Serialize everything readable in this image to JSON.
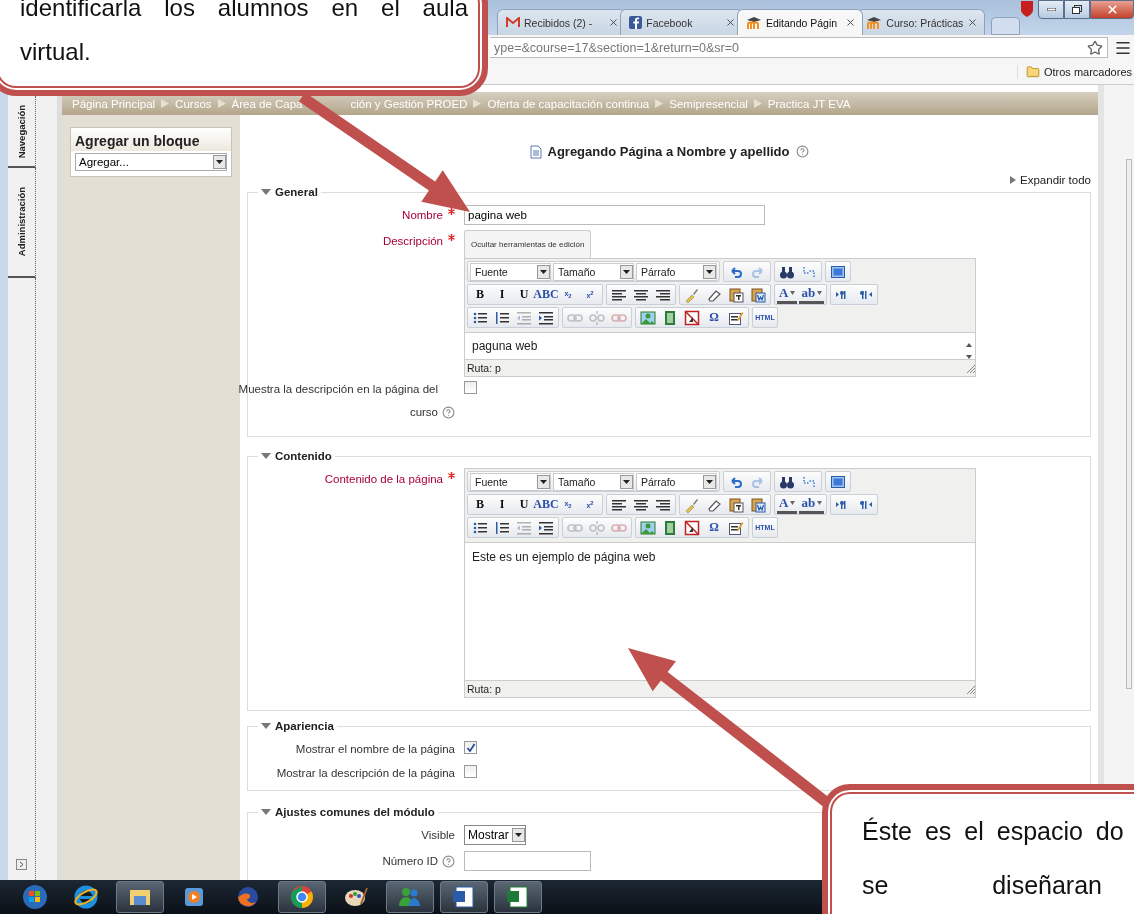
{
  "callouts": [
    {
      "lines": [
        "identificarla los alumnos en el aula",
        "virtual."
      ]
    },
    {
      "lines": [
        "Éste es el espacio do",
        "se diseñaran"
      ]
    }
  ],
  "browser": {
    "tabs": [
      {
        "title": "Recibidos (2) -",
        "kind": "mail",
        "selected": false
      },
      {
        "title": "Facebook",
        "kind": "facebook",
        "selected": false
      },
      {
        "title": "Editando Págin",
        "kind": "moodle",
        "selected": true
      },
      {
        "title": "Curso: Prácticas",
        "kind": "moodle",
        "selected": false
      }
    ],
    "url": "ype=&course=17&section=1&return=0&sr=0",
    "bookmarks": [
      "Otros marcadores"
    ]
  },
  "dock": {
    "tabs": [
      "Navegación",
      "Administración"
    ]
  },
  "breadcrumb": [
    [
      "Página Principal"
    ],
    [
      "Cursos"
    ],
    [
      "Área de Capa",
      "ción y Gestión PROED"
    ],
    [
      "Oferta de capacitación continua"
    ],
    [
      "Semipresencial"
    ],
    [
      "Practica JT EVA"
    ]
  ],
  "block": {
    "title": "Agregar un bloque",
    "select": "Agregar..."
  },
  "heading": "Agregando Página a Nombre y apellido",
  "expand_all": "Expandir todo",
  "sections": [
    {
      "legend": "General",
      "expanded": true,
      "fields": [
        {
          "kind": "text",
          "label": "Nombre",
          "required": true,
          "value": "pagina web"
        },
        {
          "kind": "editor",
          "label": "Descripción",
          "required": true,
          "editor": {
            "hide_tools": "Ocultar herramientas de edición",
            "toolbar": [
              [
                [
                  {
                    "kind": "select",
                    "label": "Fuente"
                  },
                  {
                    "kind": "select",
                    "label": "Tamaño"
                  },
                  {
                    "kind": "select",
                    "label": "Párrafo"
                  }
                ],
                [
                  {
                    "kind": "icon",
                    "disabled": false
                  },
                  {
                    "kind": "icon",
                    "disabled": true
                  }
                ],
                [
                  {
                    "kind": "icon",
                    "disabled": false
                  },
                  {
                    "kind": "icon",
                    "disabled": false
                  }
                ],
                [
                  {
                    "kind": "icon",
                    "disabled": false
                  }
                ]
              ],
              [
                [
                  {
                    "kind": "glyph",
                    "label": "B"
                  },
                  {
                    "kind": "glyph",
                    "label": "I"
                  },
                  {
                    "kind": "glyph",
                    "label": "U"
                  },
                  {
                    "kind": "glyph",
                    "label": "ABC"
                  },
                  {
                    "kind": "glyph",
                    "label": "x$_{2}$"
                  },
                  {
                    "kind": "glyph",
                    "label": "x$^{2}$"
                  }
                ],
                [
                  {
                    "kind": "icon",
                    "disabled": false
                  },
                  {
                    "kind": "icon",
                    "disabled": false
                  },
                  {
                    "kind": "icon",
                    "disabled": false
                  }
                ],
                [
                  {
                    "kind": "icon",
                    "disabled": false
                  },
                  {
                    "kind": "icon",
                    "disabled": false
                  },
                  {
                    "kind": "icon",
                    "disabled": false
                  },
                  {
                    "kind": "icon",
                    "disabled": false
                  }
                ],
                [
                  {
                    "kind": "menu",
                    "label": "A"
                  },
                  {
                    "kind": "menu",
                    "label": "ab"
                  }
                ],
                [
                  {
                    "kind": "icon",
                    "disabled": false
                  },
                  {
                    "kind": "icon",
                    "disabled": false
                  }
                ]
              ],
              [
                [
                  {
                    "kind": "icon",
                    "disabled": false
                  },
                  {
                    "kind": "icon",
                    "disabled": false
                  },
                  {
                    "kind": "icon",
                    "disabled": true
                  },
                  {
                    "kind": "icon",
                    "disabled": false
                  }
                ],
                [
                  {
                    "kind": "icon",
                    "disabled": true
                  },
                  {
                    "kind": "icon",
                    "disabled": true
                  },
                  {
                    "kind": "icon",
                    "disabled": true
                  }
                ],
                [
                  {
                    "kind": "icon",
                    "disabled": false
                  },
                  {
                    "kind": "icon",
                    "disabled": false
                  },
                  {
                    "kind": "icon",
                    "disabled": false
                  },
                  {
                    "kind": "glyph",
                    "label": "Ω"
                  },
                  {
                    "kind": "icon",
                    "disabled": false
                  }
                ],
                [
                  {
                    "kind": "glyph",
                    "label": "HTML"
                  }
                ]
              ]
            ],
            "content": "paguna web",
            "path": "Ruta: p"
          }
        },
        {
          "kind": "checkbox",
          "label": "Muestra la descripción en la página del curso",
          "help": true,
          "checked": false
        }
      ]
    },
    {
      "legend": "Contenido",
      "expanded": true,
      "fields": [
        {
          "kind": "content_editor",
          "label": "Contenido de la página",
          "required": true,
          "editor": {
            "toolbar": [
              [
                [
                  {
                    "kind": "select",
                    "label": "Fuente"
                  },
                  {
                    "kind": "select",
                    "label": "Tamaño"
                  },
                  {
                    "kind": "select",
                    "label": "Párrafo"
                  }
                ],
                [
                  {
                    "kind": "icon",
                    "disabled": false
                  },
                  {
                    "kind": "icon",
                    "disabled": true
                  }
                ],
                [
                  {
                    "kind": "icon",
                    "disabled": false
                  },
                  {
                    "kind": "icon",
                    "disabled": false
                  }
                ],
                [
                  {
                    "kind": "icon",
                    "disabled": false
                  }
                ]
              ],
              [
                [
                  {
                    "kind": "glyph",
                    "label": "B"
                  },
                  {
                    "kind": "glyph",
                    "label": "I"
                  },
                  {
                    "kind": "glyph",
                    "label": "U"
                  },
                  {
                    "kind": "glyph",
                    "label": "ABC"
                  },
                  {
                    "kind": "glyph",
                    "label": "x$_{2}$"
                  },
                  {
                    "kind": "glyph",
                    "label": "x$^{2}$"
                  }
                ],
                [
                  {
                    "kind": "icon",
                    "disabled": false
                  },
                  {
                    "kind": "icon",
                    "disabled": false
                  },
                  {
                    "kind": "icon",
                    "disabled": false
                  }
                ],
                [
                  {
                    "kind": "icon",
                    "disabled": false
                  },
                  {
                    "kind": "icon",
                    "disabled": false
                  },
                  {
                    "kind": "icon",
                    "disabled": false
                  },
                  {
                    "kind": "icon",
                    "disabled": false
                  }
                ],
                [
                  {
                    "kind": "menu",
                    "label": "A"
                  },
                  {
                    "kind": "menu",
                    "label": "ab"
                  }
                ],
                [
                  {
                    "kind": "icon",
                    "disabled": false
                  },
                  {
                    "kind": "icon",
                    "disabled": false
                  }
                ]
              ],
              [
                [
                  {
                    "kind": "icon",
                    "disabled": false
                  },
                  {
                    "kind": "icon",
                    "disabled": false
                  },
                  {
                    "kind": "icon",
                    "disabled": true
                  },
                  {
                    "kind": "icon",
                    "disabled": false
                  }
                ],
                [
                  {
                    "kind": "icon",
                    "disabled": true
                  },
                  {
                    "kind": "icon",
                    "disabled": true
                  },
                  {
                    "kind": "icon",
                    "disabled": true
                  }
                ],
                [
                  {
                    "kind": "icon",
                    "disabled": false
                  },
                  {
                    "kind": "icon",
                    "disabled": false
                  },
                  {
                    "kind": "icon",
                    "disabled": false
                  },
                  {
                    "kind": "glyph",
                    "label": "Ω"
                  },
                  {
                    "kind": "icon",
                    "disabled": false
                  }
                ],
                [
                  {
                    "kind": "glyph",
                    "label": "HTML"
                  }
                ]
              ]
            ],
            "content": "Este es un ejemplo de página web",
            "path": "Ruta: p"
          }
        }
      ]
    },
    {
      "legend": "Apariencia",
      "expanded": true,
      "fields": [
        {
          "kind": "checkbox",
          "label": "Mostrar el nombre de la página",
          "checked": true
        },
        {
          "kind": "checkbox",
          "label": "Mostrar la descripción de la página",
          "checked": false
        }
      ]
    },
    {
      "legend": "Ajustes comunes del módulo",
      "expanded": true,
      "fields": [
        {
          "kind": "select",
          "label": "Visible",
          "value": "Mostrar"
        },
        {
          "kind": "text",
          "label": "Número ID",
          "help": true
        }
      ]
    }
  ]
}
